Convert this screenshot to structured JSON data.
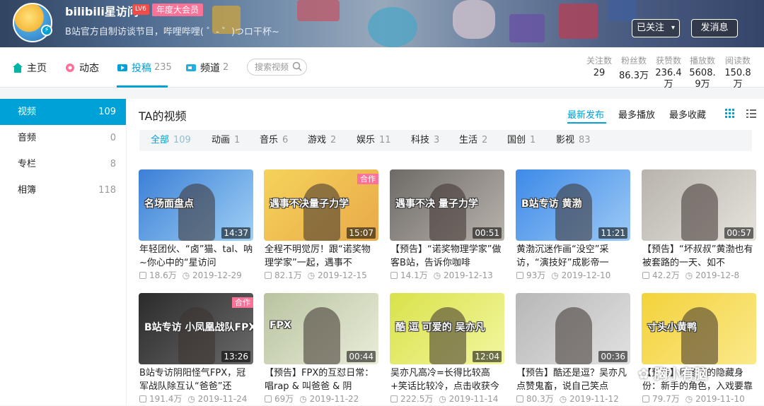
{
  "header": {
    "username": "bilibili星访问",
    "level": "LV6",
    "vip": "年度大会员",
    "sign": "B站官方自制访谈节目，哔哩哔哩( ゜- ゜)つロ干杯~",
    "follow_label": "已关注",
    "message_label": "发消息"
  },
  "nav": {
    "items": [
      {
        "label": "主页",
        "count": ""
      },
      {
        "label": "动态",
        "count": ""
      },
      {
        "label": "投稿",
        "count": "235"
      },
      {
        "label": "频道",
        "count": "2"
      }
    ],
    "search_placeholder": "搜索视频",
    "stats": [
      {
        "label": "关注数",
        "value": "29"
      },
      {
        "label": "粉丝数",
        "value": "86.3万"
      },
      {
        "label": "获赞数",
        "value": "236.4万"
      },
      {
        "label": "播放数",
        "value": "5608.9万"
      },
      {
        "label": "阅读数",
        "value": "150.8万"
      }
    ]
  },
  "sidebar": {
    "items": [
      {
        "label": "视频",
        "count": "109"
      },
      {
        "label": "音频",
        "count": "0"
      },
      {
        "label": "专栏",
        "count": "8"
      },
      {
        "label": "相簿",
        "count": "118"
      }
    ]
  },
  "main": {
    "title": "TA的视频",
    "sort": [
      "最新发布",
      "最多播放",
      "最多收藏"
    ],
    "categories": [
      {
        "label": "全部",
        "count": "109"
      },
      {
        "label": "动画",
        "count": "1"
      },
      {
        "label": "音乐",
        "count": "6"
      },
      {
        "label": "游戏",
        "count": "2"
      },
      {
        "label": "娱乐",
        "count": "11"
      },
      {
        "label": "科技",
        "count": "3"
      },
      {
        "label": "生活",
        "count": "2"
      },
      {
        "label": "国创",
        "count": "1"
      },
      {
        "label": "影视",
        "count": "83"
      }
    ],
    "videos": [
      {
        "title": "年轻团伙、“卤”猫、tal、呐~你心中的“星访问",
        "plays": "18.6万",
        "date": "2019-12-29",
        "duration": "14:37",
        "thumb_text": "名场面盘点",
        "tag": "",
        "color1": "#3b7fd6",
        "color2": "#9fd0f5"
      },
      {
        "title": "全程不明觉厉！跟“诺奖物理学家”一起，遇事不",
        "plays": "82.1万",
        "date": "2019-12-15",
        "duration": "15:07",
        "thumb_text": "遇事不决量子力学",
        "tag": "合作",
        "color1": "#f5d35a",
        "color2": "#e9a94a"
      },
      {
        "title": "【预告】“诺奖物理学家”做客B站，告诉你咖啡",
        "plays": "14.1万",
        "date": "2019-12-13",
        "duration": "00:51",
        "thumb_text": "遇事不决 量子力学",
        "tag": "",
        "color1": "#6e6a66",
        "color2": "#b9b3ad"
      },
      {
        "title": "黄渤沉迷作画“没空”采访，“演技好”成影帝一",
        "plays": "93万",
        "date": "2019-12-10",
        "duration": "11:21",
        "thumb_text": "B站专访 黄渤",
        "tag": "",
        "color1": "#3d8ae8",
        "color2": "#9cc9f5"
      },
      {
        "title": "【预告】“坏叔叔”黄渤也有被套路的一天、如不",
        "plays": "42.2万",
        "date": "2019-12-8",
        "duration": "00:57",
        "thumb_text": "",
        "tag": "",
        "color1": "#b8b4ad",
        "color2": "#e6e2dc"
      },
      {
        "title": "B站专访阴阳怪气FPX，冠军战队除互认“爸爸”还",
        "plays": "191.4万",
        "date": "2019-11-24",
        "duration": "13:26",
        "thumb_text": "B站专访 小凤凰战队FPX",
        "tag": "合作",
        "color1": "#2b2b2b",
        "color2": "#6a6a6a"
      },
      {
        "title": "【预告】FPX的互怼日常：唱rap & 叫爸爸 & 阴",
        "plays": "69万",
        "date": "2019-11-22",
        "duration": "00:44",
        "thumb_text": "FPX",
        "tag": "",
        "color1": "#b9c3a0",
        "color2": "#e9edd9"
      },
      {
        "title": "吴亦凡高冷=长得比较高+笑话比较冷，点击收获今",
        "plays": "222.5万",
        "date": "2019-11-14",
        "duration": "12:04",
        "thumb_text": "酷 逗 可爱的 吴亦凡",
        "tag": "",
        "color1": "#d9e24a",
        "color2": "#f3f6a0"
      },
      {
        "title": "【预告】酷还是逗？吴亦凡点赞鬼畜，说自己笑点",
        "plays": "80.3万",
        "date": "2019-11-12",
        "duration": "00:36",
        "thumb_text": "",
        "tag": "",
        "color1": "#b7b7b7",
        "color2": "#e1e1e1"
      },
      {
        "title": "【预告】周冬雨的隐藏身份：新手的角色，入戏要靠心",
        "plays": "79.7万",
        "date": "2019-11-10",
        "duration": "",
        "thumb_text": "寸头小黄鸭",
        "tag": "",
        "color1": "#f3d23a",
        "color2": "#fbe98b"
      }
    ]
  },
  "watermark": "胸小有脑",
  "colors": {
    "accent": "#00a1d6",
    "pink": "#fb7299"
  }
}
